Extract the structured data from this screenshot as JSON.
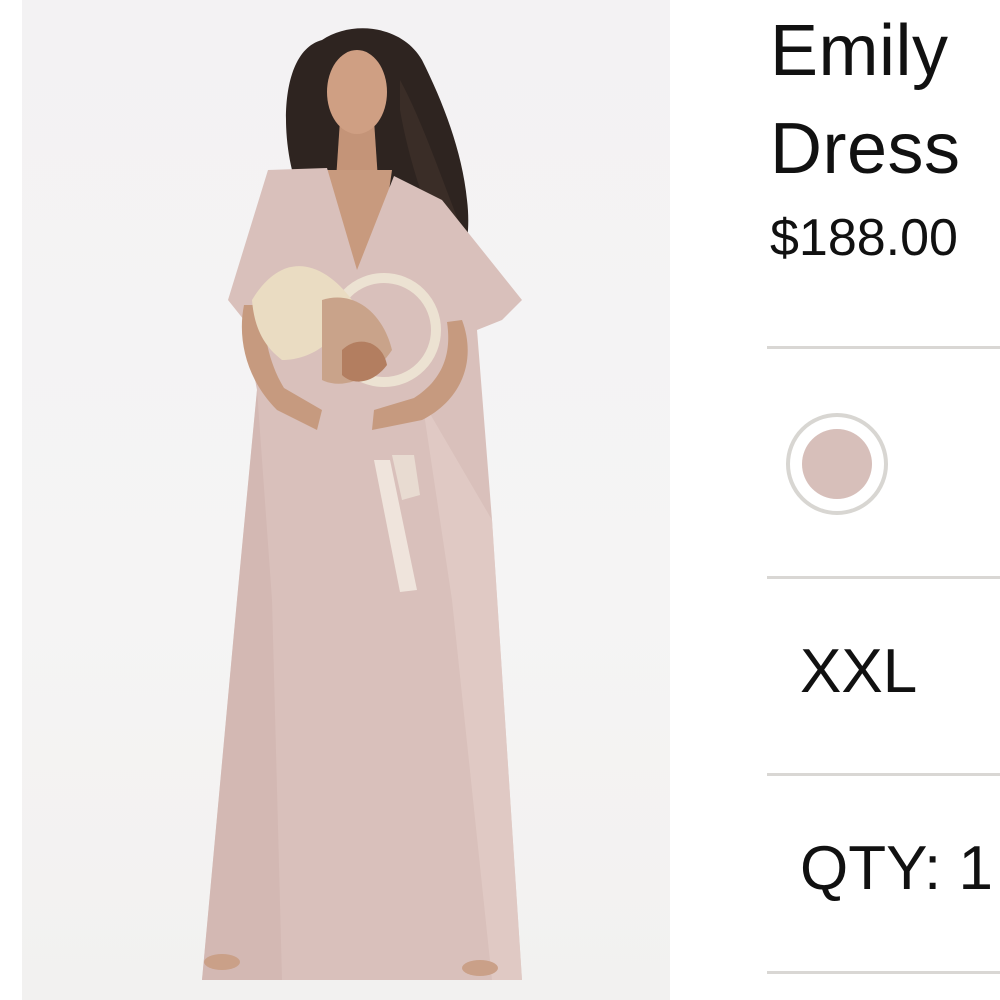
{
  "product": {
    "title_line1": "Emily",
    "title_line2": "Dress",
    "price": "$188.00",
    "color": {
      "swatch": "#d7bfba"
    },
    "size": "XXL",
    "quantity": "QTY: 1"
  },
  "image": {
    "icon": "product-photo"
  }
}
